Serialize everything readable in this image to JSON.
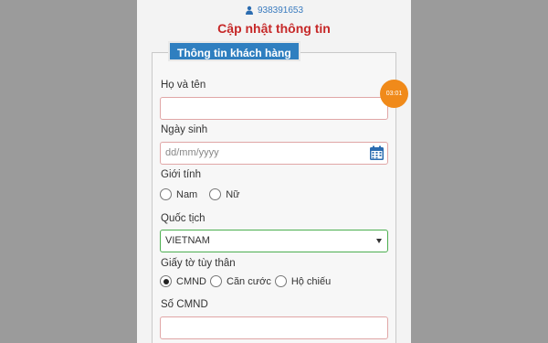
{
  "header": {
    "phone_number": "938391653",
    "title": "Cập nhật thông tin"
  },
  "form": {
    "legend": "Thông tin khách hàng",
    "full_name": {
      "label": "Họ và tên",
      "value": ""
    },
    "dob": {
      "label": "Ngày sinh",
      "placeholder": "dd/mm/yyyy"
    },
    "gender": {
      "label": "Giới tính",
      "options": [
        "Nam",
        "Nữ"
      ]
    },
    "nationality": {
      "label": "Quốc tịch",
      "selected": "VIETNAM"
    },
    "id_type": {
      "label": "Giấy tờ tùy thân",
      "options": [
        "CMND",
        "Căn cước",
        "Hộ chiếu"
      ],
      "selected": "CMND"
    },
    "id_number": {
      "label": "Số CMND",
      "value": ""
    }
  },
  "timer": {
    "text": "03:01"
  },
  "colors": {
    "title": "#c62828",
    "legend_bg": "#2f7fc0",
    "timer_bg": "#f08a1a",
    "select_border": "#4caf50"
  }
}
